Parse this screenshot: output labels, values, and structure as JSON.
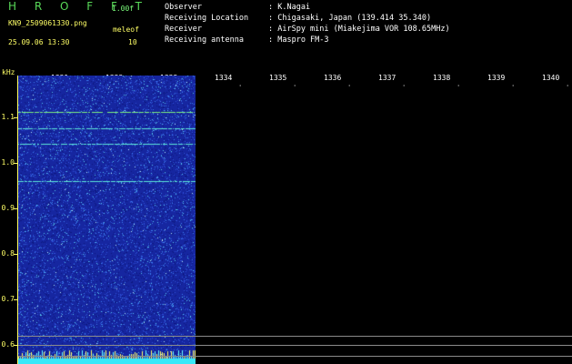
{
  "header": {
    "app_name": "H R O F F T",
    "version": "1.00f",
    "filename": "KN9_2509061330.png",
    "meleof_label": "meleof",
    "datetime": "25.09.06 13:30",
    "meleof_value": "10"
  },
  "info": [
    {
      "label": "Observer",
      "value": ": K.Nagai"
    },
    {
      "label": "Receiving Location",
      "value": ": Chigasaki, Japan (139.414 35.340)"
    },
    {
      "label": "Receiver",
      "value": ": AirSpy mini (Miakejima VOR 108.65MHz)"
    },
    {
      "label": "Receiving antenna",
      "value": ": Maspro FM-3"
    }
  ],
  "y_axis": {
    "unit": "kHz",
    "labels": [
      "1.1",
      "1.0",
      "0.9",
      "0.8",
      "0.7",
      "0.6"
    ]
  },
  "x_axis": {
    "labels": [
      "1331",
      "1332",
      "1333",
      "1334",
      "1335",
      "1336",
      "1337",
      "1338",
      "1339",
      "1340"
    ]
  },
  "colors": {
    "background": "#000000",
    "spectrogram_base": "#1a2bb0",
    "signal_line": "#4ce8c8",
    "axis": "#ffff66",
    "guide_line": "#8a8a8a"
  }
}
